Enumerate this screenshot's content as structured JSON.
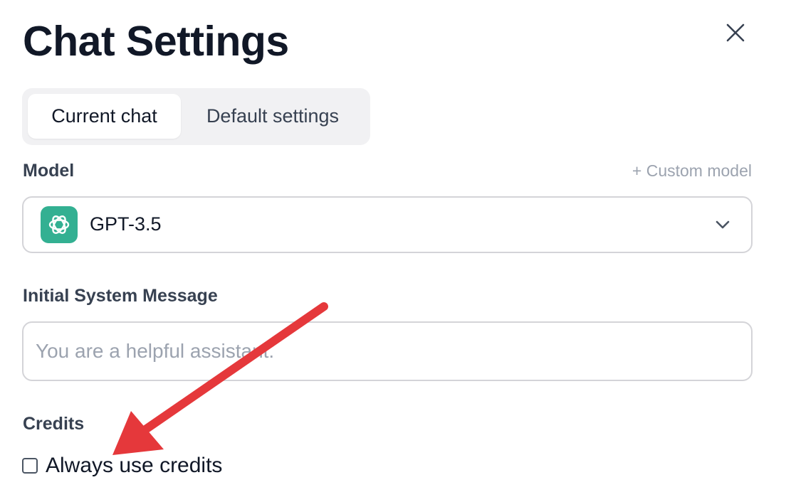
{
  "header": {
    "title": "Chat Settings"
  },
  "tabs": [
    {
      "label": "Current chat",
      "active": true
    },
    {
      "label": "Default settings",
      "active": false
    }
  ],
  "model": {
    "label": "Model",
    "custom_link": "+ Custom model",
    "selected": "GPT-3.5",
    "icon": "openai-icon"
  },
  "system_message": {
    "label": "Initial System Message",
    "value": "",
    "placeholder": "You are a helpful assistant."
  },
  "credits": {
    "label": "Credits",
    "checkbox_label": "Always use credits",
    "checked": false
  },
  "colors": {
    "accent_annotation": "#e5383b",
    "model_icon_bg": "#10a37f"
  }
}
